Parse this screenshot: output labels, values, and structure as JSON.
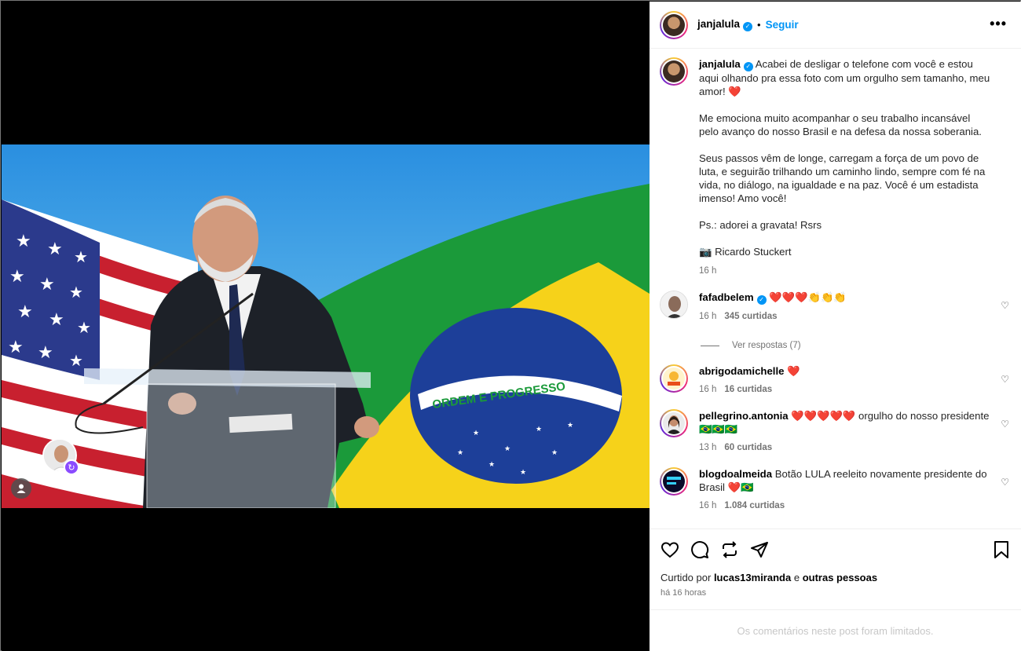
{
  "post": {
    "author": "janjalula",
    "follow_label": "Seguir",
    "separator": "•",
    "more_label": "•••"
  },
  "caption": {
    "user": "janjalula",
    "p1": "Acabei de desligar o telefone com você e estou aqui olhando pra essa foto com um orgulho sem tamanho, meu amor! ❤️",
    "p2": "Me emociona muito acompanhar o seu trabalho incansável pelo avanço do nosso Brasil e na defesa da nossa soberania.",
    "p3": "Seus passos vêm de longe, carregam a força de um povo de luta, e seguirão trilhando um caminho lindo, sempre com fé na vida, no diálogo, na igualdade e na paz. Você é um estadista imenso! Amo você!",
    "p4": "Ps.: adorei a gravata! Rsrs",
    "p5": "📷 Ricardo Stuckert",
    "time": "16 h"
  },
  "comments": [
    {
      "user": "fafadbelem",
      "text": "❤️❤️❤️👏👏👏",
      "time": "16 h",
      "likes": "345 curtidas",
      "replies": "Ver respostas (7)"
    },
    {
      "user": "abrigodamichelle",
      "text": "❤️",
      "time": "16 h",
      "likes": "16 curtidas"
    },
    {
      "user": "pellegrino.antonia",
      "text": "❤️❤️❤️❤️❤️ orgulho do nosso presidente 🇧🇷🇧🇷🇧🇷",
      "time": "13 h",
      "likes": "60 curtidas"
    },
    {
      "user": "blogdoalmeida",
      "text": "Botão LULA reeleito novamente presidente do Brasil ❤️🇧🇷",
      "time": "16 h",
      "likes": "1.084 curtidas"
    }
  ],
  "likes": {
    "prefix": "Curtido por",
    "user": "lucas13miranda",
    "middle": "e",
    "others": "outras pessoas",
    "ago": "há 16 horas"
  },
  "limited_text": "Os comentários neste post foram limitados.",
  "photo": {
    "banner_text": "ORDEM E PROGRESSO"
  },
  "icons": {
    "like": "heart-icon",
    "comment": "comment-icon",
    "repost": "repost-icon",
    "share": "share-icon",
    "save": "bookmark-icon"
  }
}
